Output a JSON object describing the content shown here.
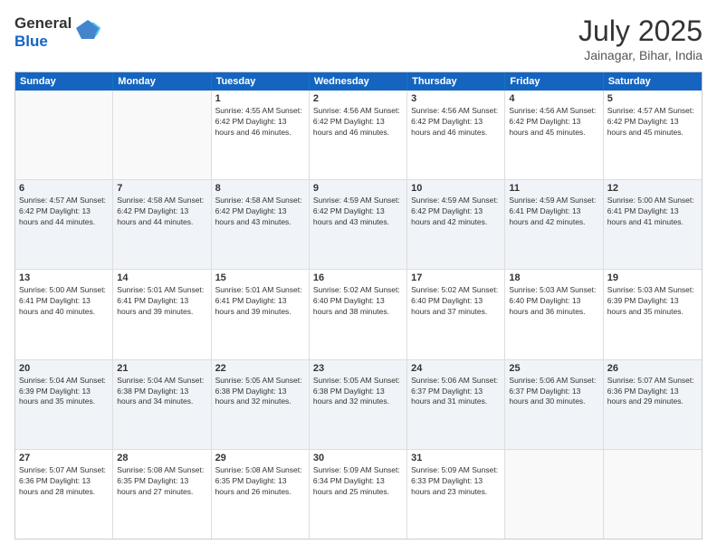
{
  "header": {
    "logo_general": "General",
    "logo_blue": "Blue",
    "month_title": "July 2025",
    "location": "Jainagar, Bihar, India"
  },
  "days_of_week": [
    "Sunday",
    "Monday",
    "Tuesday",
    "Wednesday",
    "Thursday",
    "Friday",
    "Saturday"
  ],
  "weeks": [
    [
      {
        "day": "",
        "info": ""
      },
      {
        "day": "",
        "info": ""
      },
      {
        "day": "1",
        "info": "Sunrise: 4:55 AM\nSunset: 6:42 PM\nDaylight: 13 hours\nand 46 minutes."
      },
      {
        "day": "2",
        "info": "Sunrise: 4:56 AM\nSunset: 6:42 PM\nDaylight: 13 hours\nand 46 minutes."
      },
      {
        "day": "3",
        "info": "Sunrise: 4:56 AM\nSunset: 6:42 PM\nDaylight: 13 hours\nand 46 minutes."
      },
      {
        "day": "4",
        "info": "Sunrise: 4:56 AM\nSunset: 6:42 PM\nDaylight: 13 hours\nand 45 minutes."
      },
      {
        "day": "5",
        "info": "Sunrise: 4:57 AM\nSunset: 6:42 PM\nDaylight: 13 hours\nand 45 minutes."
      }
    ],
    [
      {
        "day": "6",
        "info": "Sunrise: 4:57 AM\nSunset: 6:42 PM\nDaylight: 13 hours\nand 44 minutes."
      },
      {
        "day": "7",
        "info": "Sunrise: 4:58 AM\nSunset: 6:42 PM\nDaylight: 13 hours\nand 44 minutes."
      },
      {
        "day": "8",
        "info": "Sunrise: 4:58 AM\nSunset: 6:42 PM\nDaylight: 13 hours\nand 43 minutes."
      },
      {
        "day": "9",
        "info": "Sunrise: 4:59 AM\nSunset: 6:42 PM\nDaylight: 13 hours\nand 43 minutes."
      },
      {
        "day": "10",
        "info": "Sunrise: 4:59 AM\nSunset: 6:42 PM\nDaylight: 13 hours\nand 42 minutes."
      },
      {
        "day": "11",
        "info": "Sunrise: 4:59 AM\nSunset: 6:41 PM\nDaylight: 13 hours\nand 42 minutes."
      },
      {
        "day": "12",
        "info": "Sunrise: 5:00 AM\nSunset: 6:41 PM\nDaylight: 13 hours\nand 41 minutes."
      }
    ],
    [
      {
        "day": "13",
        "info": "Sunrise: 5:00 AM\nSunset: 6:41 PM\nDaylight: 13 hours\nand 40 minutes."
      },
      {
        "day": "14",
        "info": "Sunrise: 5:01 AM\nSunset: 6:41 PM\nDaylight: 13 hours\nand 39 minutes."
      },
      {
        "day": "15",
        "info": "Sunrise: 5:01 AM\nSunset: 6:41 PM\nDaylight: 13 hours\nand 39 minutes."
      },
      {
        "day": "16",
        "info": "Sunrise: 5:02 AM\nSunset: 6:40 PM\nDaylight: 13 hours\nand 38 minutes."
      },
      {
        "day": "17",
        "info": "Sunrise: 5:02 AM\nSunset: 6:40 PM\nDaylight: 13 hours\nand 37 minutes."
      },
      {
        "day": "18",
        "info": "Sunrise: 5:03 AM\nSunset: 6:40 PM\nDaylight: 13 hours\nand 36 minutes."
      },
      {
        "day": "19",
        "info": "Sunrise: 5:03 AM\nSunset: 6:39 PM\nDaylight: 13 hours\nand 35 minutes."
      }
    ],
    [
      {
        "day": "20",
        "info": "Sunrise: 5:04 AM\nSunset: 6:39 PM\nDaylight: 13 hours\nand 35 minutes."
      },
      {
        "day": "21",
        "info": "Sunrise: 5:04 AM\nSunset: 6:38 PM\nDaylight: 13 hours\nand 34 minutes."
      },
      {
        "day": "22",
        "info": "Sunrise: 5:05 AM\nSunset: 6:38 PM\nDaylight: 13 hours\nand 32 minutes."
      },
      {
        "day": "23",
        "info": "Sunrise: 5:05 AM\nSunset: 6:38 PM\nDaylight: 13 hours\nand 32 minutes."
      },
      {
        "day": "24",
        "info": "Sunrise: 5:06 AM\nSunset: 6:37 PM\nDaylight: 13 hours\nand 31 minutes."
      },
      {
        "day": "25",
        "info": "Sunrise: 5:06 AM\nSunset: 6:37 PM\nDaylight: 13 hours\nand 30 minutes."
      },
      {
        "day": "26",
        "info": "Sunrise: 5:07 AM\nSunset: 6:36 PM\nDaylight: 13 hours\nand 29 minutes."
      }
    ],
    [
      {
        "day": "27",
        "info": "Sunrise: 5:07 AM\nSunset: 6:36 PM\nDaylight: 13 hours\nand 28 minutes."
      },
      {
        "day": "28",
        "info": "Sunrise: 5:08 AM\nSunset: 6:35 PM\nDaylight: 13 hours\nand 27 minutes."
      },
      {
        "day": "29",
        "info": "Sunrise: 5:08 AM\nSunset: 6:35 PM\nDaylight: 13 hours\nand 26 minutes."
      },
      {
        "day": "30",
        "info": "Sunrise: 5:09 AM\nSunset: 6:34 PM\nDaylight: 13 hours\nand 25 minutes."
      },
      {
        "day": "31",
        "info": "Sunrise: 5:09 AM\nSunset: 6:33 PM\nDaylight: 13 hours\nand 23 minutes."
      },
      {
        "day": "",
        "info": ""
      },
      {
        "day": "",
        "info": ""
      }
    ]
  ]
}
